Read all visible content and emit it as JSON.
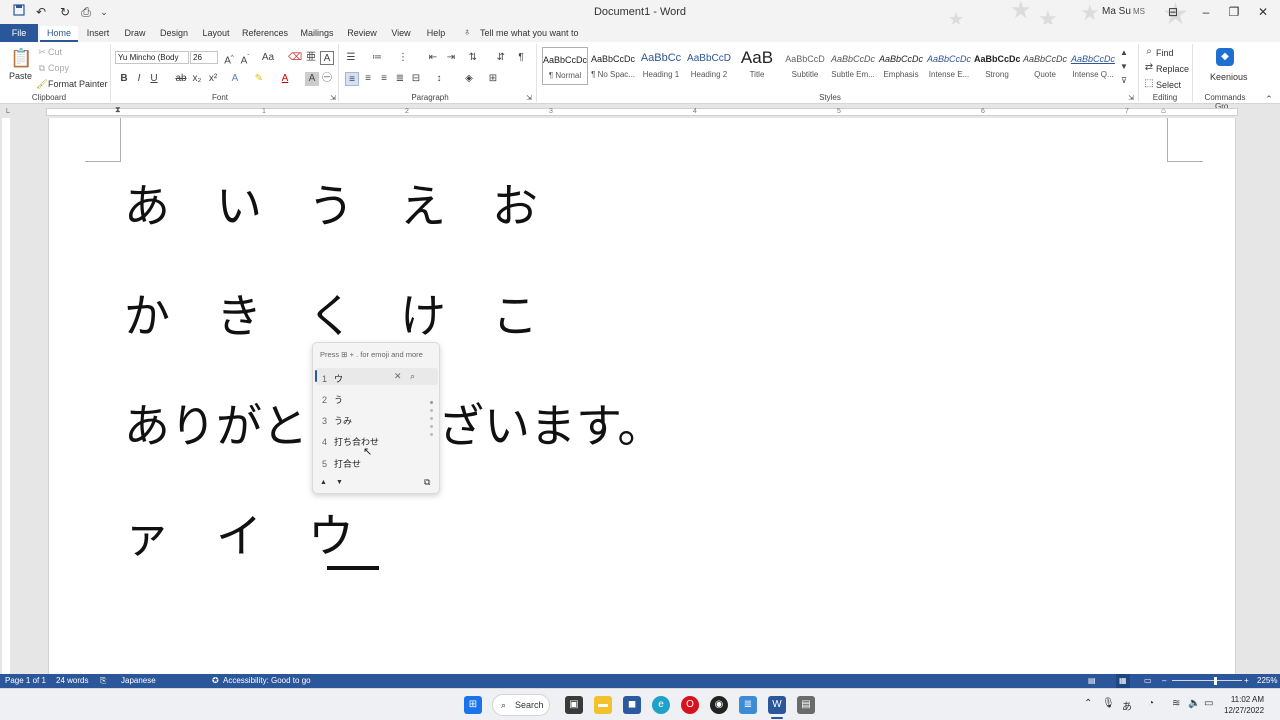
{
  "titlebar": {
    "title": "Document1 - Word",
    "user_name": "Ma Su",
    "user_initials": "MS",
    "icons": [
      "save-icon",
      "undo-icon",
      "redo-icon",
      "print-preview-icon",
      "customize-icon"
    ]
  },
  "tabs": [
    "File",
    "Home",
    "Insert",
    "Draw",
    "Design",
    "Layout",
    "References",
    "Mailings",
    "Review",
    "View",
    "Help"
  ],
  "tell_me": "Tell me what you want to do",
  "ribbon": {
    "clipboard": {
      "label": "Clipboard",
      "paste": "Paste",
      "cut": "Cut",
      "copy": "Copy",
      "format_painter": "Format Painter"
    },
    "font": {
      "label": "Font",
      "font_name": "Yu Mincho (Body",
      "font_size": "26"
    },
    "paragraph": {
      "label": "Paragraph"
    },
    "styles": {
      "label": "Styles",
      "items": [
        {
          "preview": "AaBbCcDc",
          "name": "¶ Normal"
        },
        {
          "preview": "AaBbCcDc",
          "name": "¶ No Spac..."
        },
        {
          "preview": "AaBbCc",
          "name": "Heading 1"
        },
        {
          "preview": "AaBbCcD",
          "name": "Heading 2"
        },
        {
          "preview": "AaB",
          "name": "Title"
        },
        {
          "preview": "AaBbCcD",
          "name": "Subtitle"
        },
        {
          "preview": "AaBbCcDc",
          "name": "Subtle Em..."
        },
        {
          "preview": "AaBbCcDc",
          "name": "Emphasis"
        },
        {
          "preview": "AaBbCcDc",
          "name": "Intense E..."
        },
        {
          "preview": "AaBbCcDc",
          "name": "Strong"
        },
        {
          "preview": "AaBbCcDc",
          "name": "Quote"
        },
        {
          "preview": "AaBbCcDc",
          "name": "Intense Q..."
        }
      ]
    },
    "editing": {
      "label": "Editing",
      "find": "Find",
      "replace": "Replace",
      "select": "Select"
    },
    "commands": {
      "label": "Commands Gro...",
      "keenious": "Keenious"
    }
  },
  "ruler": [
    "1",
    "2",
    "3",
    "4",
    "5",
    "6",
    "7"
  ],
  "document": {
    "line1": "あ　い　う　え　お",
    "line2": "か　き　く　け　こ",
    "line3_left": "ありがと",
    "line3_right": "ざいます。",
    "line4": "ァ　イ　ウ"
  },
  "ime": {
    "hint": "Press ⊞ + . for emoji and more",
    "candidates": [
      {
        "num": "1",
        "text": "ウ"
      },
      {
        "num": "2",
        "text": "う"
      },
      {
        "num": "3",
        "text": "うみ"
      },
      {
        "num": "4",
        "text": "打ち合わせ"
      },
      {
        "num": "5",
        "text": "打合せ"
      }
    ]
  },
  "status": {
    "page": "Page 1 of 1",
    "words": "24 words",
    "language": "Japanese",
    "accessibility": "Accessibility: Good to go",
    "zoom": "225%"
  },
  "taskbar": {
    "search": "Search",
    "ime_mode": "あ",
    "time": "11:02 AM",
    "date": "12/27/2022"
  },
  "colors": {
    "accent": "#2b579a",
    "page": "#ffffff",
    "ribbon_bg": "#f3f3f3"
  }
}
